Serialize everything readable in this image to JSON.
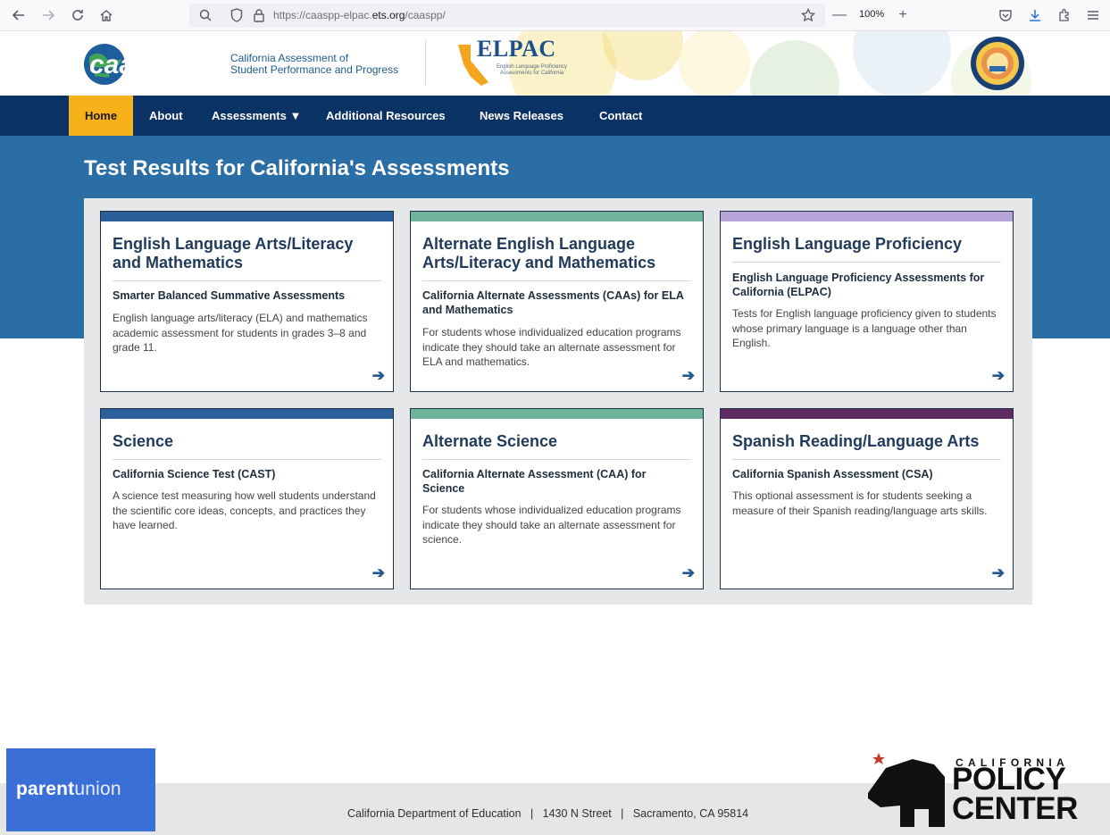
{
  "browser": {
    "url_prefix": "https://caaspp-elpac.",
    "url_domain": "ets.org",
    "url_path": "/caaspp/",
    "zoom": "100%",
    "zoom_out": "—",
    "zoom_in": "+"
  },
  "header": {
    "logo_text": "caaspp",
    "logo_line1": "California Assessment of",
    "logo_line2": "Student Performance and Progress",
    "elpac_title": "ELPAC",
    "elpac_sub": "English Language Proficiency Assessments for California"
  },
  "nav": {
    "home": "Home",
    "about": "About",
    "assessments": "Assessments ▼",
    "additional_resources": "Additional Resources",
    "news_releases": "News Releases",
    "contact": "Contact"
  },
  "page_title": "Test Results for California's Assessments",
  "cards": [
    {
      "title": "English Language Arts/Literacy and Mathematics",
      "subtitle": "Smarter Balanced Summative Assessments",
      "desc": "English language arts/literacy (ELA) and mathematics academic assessment for students in grades 3–8 and grade 11.",
      "bar_color": "#2b5f99"
    },
    {
      "title": "Alternate English Language Arts/Literacy and Mathematics",
      "subtitle": "California Alternate Assessments (CAAs) for ELA and Mathematics",
      "desc": "For students whose individualized education programs indicate they should take an alternate assessment for ELA and mathematics.",
      "bar_color": "#6fb39a"
    },
    {
      "title": "English Language Proficiency",
      "subtitle": "English Language Proficiency Assessments for California (ELPAC)",
      "desc": "Tests for English language proficiency given to students whose primary language is a language other than English.",
      "bar_color": "#b6a4d8"
    },
    {
      "title": "Science",
      "subtitle": "California Science Test (CAST)",
      "desc": "A science test measuring how well students understand the scientific core ideas, concepts, and practices they have learned.",
      "bar_color": "#2b5f99"
    },
    {
      "title": "Alternate Science",
      "subtitle": "California Alternate Assessment (CAA) for Science",
      "desc": "For students whose individualized education programs indicate they should take an alternate assessment for science.",
      "bar_color": "#6fb39a"
    },
    {
      "title": "Spanish Reading/Language Arts",
      "subtitle": "California Spanish Assessment (CSA)",
      "desc": "This optional assessment is for students seeking a measure of their Spanish reading/language arts skills.",
      "bar_color": "#5e2a63"
    }
  ],
  "footer": {
    "text": "California Department of Education   |   1430 N Street   |   Sacramento, CA 95814"
  },
  "overlays": {
    "parentunion_bold": "parent",
    "parentunion_light": "union",
    "cpc_small": "CALIFORNIA",
    "cpc_big1": "POLICY",
    "cpc_big2": "CENTER"
  }
}
